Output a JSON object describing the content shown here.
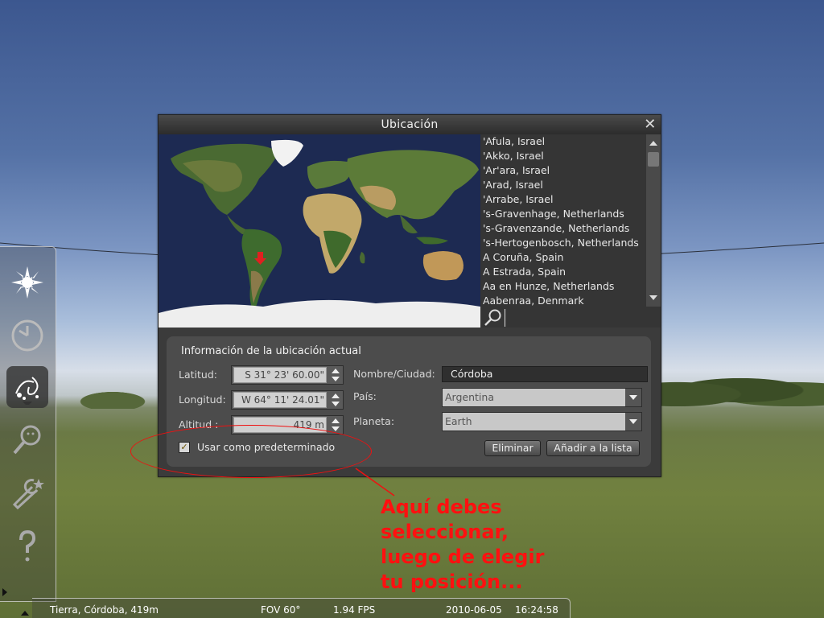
{
  "dialog": {
    "title": "Ubicación",
    "close_icon": "close-icon"
  },
  "city_list": {
    "items": [
      "'Afula, Israel",
      "'Akko, Israel",
      "'Ar'ara, Israel",
      "'Arad, Israel",
      "'Arrabe, Israel",
      "'s-Gravenhage, Netherlands",
      "'s-Gravenzande, Netherlands",
      "'s-Hertogenbosch, Netherlands",
      "A Coruña, Spain",
      "A Estrada, Spain",
      "Aa en Hunze, Netherlands",
      "Aabenraa, Denmark"
    ],
    "search_value": ""
  },
  "location_panel": {
    "title": "Información de la ubicación actual",
    "latitude_label": "Latitud:",
    "latitude_value": "S 31° 23' 60.00\"",
    "longitude_label": "Longitud:",
    "longitude_value": "W 64° 11' 24.01\"",
    "altitude_label": "Altitud :",
    "altitude_value": "419 m",
    "name_label": "Nombre/Ciudad:",
    "name_value": "Córdoba",
    "country_label": "País:",
    "country_value": "Argentina",
    "planet_label": "Planeta:",
    "planet_value": "Earth",
    "default_checkbox_label": "Usar como predeterminado",
    "default_checked": true,
    "delete_button": "Eliminar",
    "add_button": "Añadir a la lista"
  },
  "status_bar": {
    "location": "Tierra, Córdoba, 419m",
    "fov": "FOV 60°",
    "fps": "1.94 FPS",
    "date": "2010-06-05",
    "time": "16:24:58"
  },
  "annotation": {
    "lines": [
      "Aquí debes",
      "seleccionar,",
      "luego de elegir",
      "tu posición..."
    ],
    "color": "#ff1010"
  },
  "colors": {
    "dialog_bg": "#3b3b3b",
    "panel_bg": "#4c4c4c",
    "map_ocean": "#1d2a52",
    "marker": "#e02020"
  }
}
